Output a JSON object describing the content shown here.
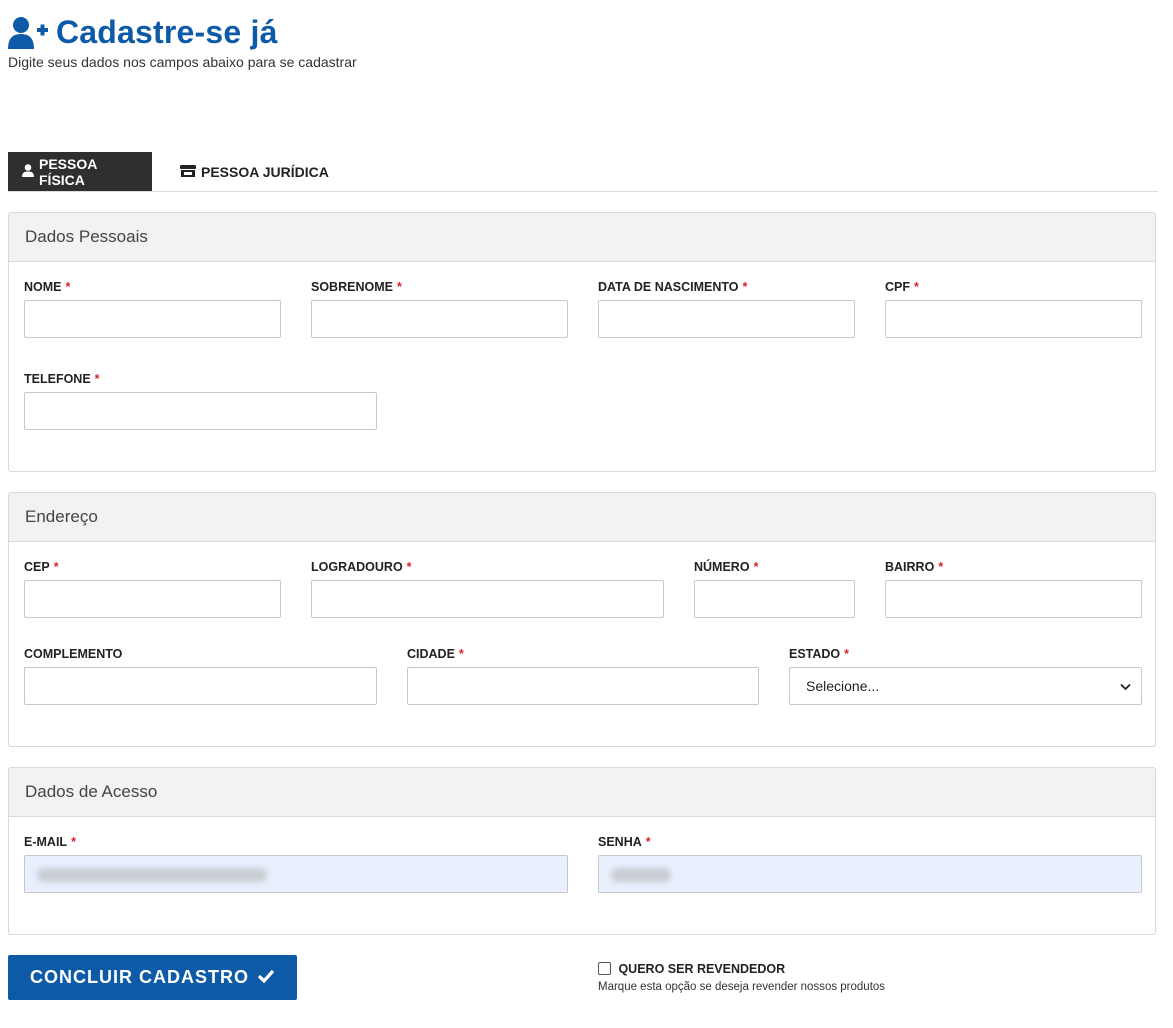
{
  "header": {
    "title": "Cadastre-se já",
    "subtitle": "Digite seus dados nos campos abaixo para se cadastrar"
  },
  "tabs": [
    {
      "label": "PESSOA FÍSICA",
      "icon": "user-icon",
      "active": true
    },
    {
      "label": "PESSOA JURÍDICA",
      "icon": "store-icon",
      "active": false
    }
  ],
  "sections": {
    "personal": {
      "title": "Dados Pessoais",
      "fields": {
        "nome": "NOME",
        "sobrenome": "SOBRENOME",
        "data_nascimento": "DATA DE NASCIMENTO",
        "cpf": "CPF",
        "telefone": "TELEFONE"
      }
    },
    "address": {
      "title": "Endereço",
      "fields": {
        "cep": "CEP",
        "logradouro": "LOGRADOURO",
        "numero": "NÚMERO",
        "bairro": "BAIRRO",
        "complemento": "COMPLEMENTO",
        "cidade": "CIDADE",
        "estado": "ESTADO"
      },
      "estado_selected": "Selecione..."
    },
    "access": {
      "title": "Dados de Acesso",
      "fields": {
        "email": "E-MAIL",
        "senha": "SENHA"
      }
    }
  },
  "required_mark": "*",
  "actions": {
    "submit_label": "CONCLUIR CADASTRO",
    "reseller_label": "QUERO SER REVENDEDOR",
    "reseller_help": "Marque esta opção se deseja revender nossos produtos"
  },
  "colors": {
    "brand": "#0d5aa7",
    "required": "#d9232e",
    "active_tab": "#2f2f2f",
    "autofill": "#e8f0fe"
  }
}
